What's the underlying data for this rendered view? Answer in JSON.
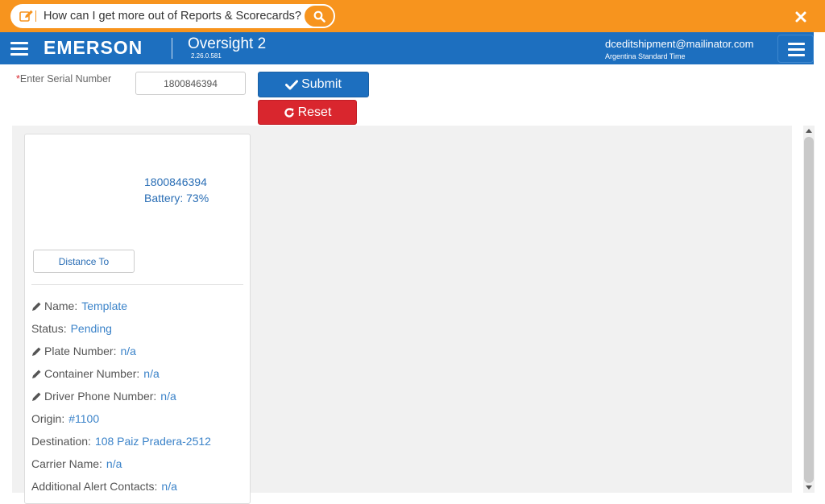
{
  "helpbar": {
    "prompt": "How can I get more out of Reports & Scorecards?",
    "icons": {
      "edit": "edit-icon",
      "search": "search-icon",
      "close": "close-icon"
    },
    "color": "#f7941e"
  },
  "navbar": {
    "brand": "EMERSON",
    "app_name": "Oversight 2",
    "version": "2.26.0.581",
    "user_email": "dceditshipment@mailinator.com",
    "timezone": "Argentina Standard Time",
    "color": "#1d6fbf"
  },
  "form": {
    "required_marker": "*",
    "serial_label": "Enter Serial Number",
    "serial_value": "1800846394",
    "submit_label": "Submit",
    "reset_label": "Reset"
  },
  "device": {
    "serial": "1800846394",
    "battery": "Battery: 73%",
    "distance_button": "Distance To"
  },
  "details": [
    {
      "label": "Name:",
      "value": "Template",
      "editable": true
    },
    {
      "label": "Status:",
      "value": "Pending",
      "editable": false
    },
    {
      "label": "Plate Number:",
      "value": "n/a",
      "editable": true
    },
    {
      "label": "Container Number:",
      "value": "n/a",
      "editable": true
    },
    {
      "label": "Driver Phone Number:",
      "value": "n/a",
      "editable": true
    },
    {
      "label": "Origin:",
      "value": "#1100",
      "editable": false
    },
    {
      "label": "Destination:",
      "value": "108 Paiz Pradera-2512",
      "editable": false
    },
    {
      "label": "Carrier Name:",
      "value": "n/a",
      "editable": false
    },
    {
      "label": "Additional Alert Contacts:",
      "value": "n/a",
      "editable": false
    }
  ]
}
